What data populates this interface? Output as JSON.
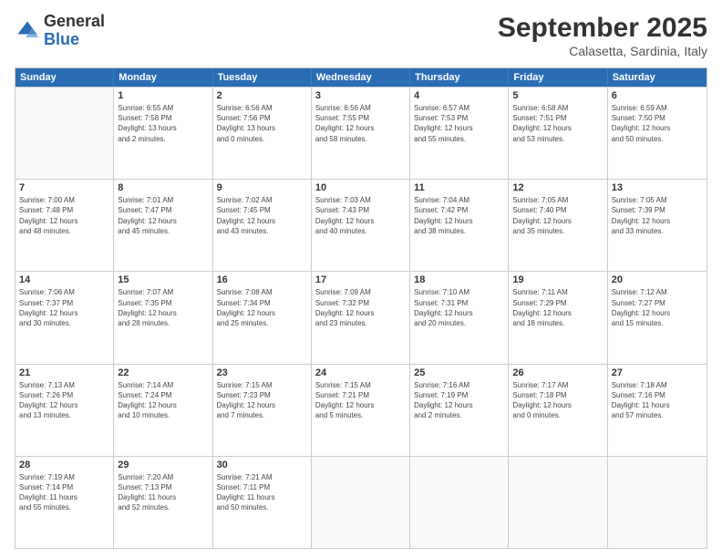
{
  "logo": {
    "general": "General",
    "blue": "Blue"
  },
  "header": {
    "month": "September 2025",
    "location": "Calasetta, Sardinia, Italy"
  },
  "weekdays": [
    "Sunday",
    "Monday",
    "Tuesday",
    "Wednesday",
    "Thursday",
    "Friday",
    "Saturday"
  ],
  "weeks": [
    [
      {
        "day": "",
        "info": ""
      },
      {
        "day": "1",
        "info": "Sunrise: 6:55 AM\nSunset: 7:58 PM\nDaylight: 13 hours\nand 2 minutes."
      },
      {
        "day": "2",
        "info": "Sunrise: 6:56 AM\nSunset: 7:56 PM\nDaylight: 13 hours\nand 0 minutes."
      },
      {
        "day": "3",
        "info": "Sunrise: 6:56 AM\nSunset: 7:55 PM\nDaylight: 12 hours\nand 58 minutes."
      },
      {
        "day": "4",
        "info": "Sunrise: 6:57 AM\nSunset: 7:53 PM\nDaylight: 12 hours\nand 55 minutes."
      },
      {
        "day": "5",
        "info": "Sunrise: 6:58 AM\nSunset: 7:51 PM\nDaylight: 12 hours\nand 53 minutes."
      },
      {
        "day": "6",
        "info": "Sunrise: 6:59 AM\nSunset: 7:50 PM\nDaylight: 12 hours\nand 50 minutes."
      }
    ],
    [
      {
        "day": "7",
        "info": "Sunrise: 7:00 AM\nSunset: 7:48 PM\nDaylight: 12 hours\nand 48 minutes."
      },
      {
        "day": "8",
        "info": "Sunrise: 7:01 AM\nSunset: 7:47 PM\nDaylight: 12 hours\nand 45 minutes."
      },
      {
        "day": "9",
        "info": "Sunrise: 7:02 AM\nSunset: 7:45 PM\nDaylight: 12 hours\nand 43 minutes."
      },
      {
        "day": "10",
        "info": "Sunrise: 7:03 AM\nSunset: 7:43 PM\nDaylight: 12 hours\nand 40 minutes."
      },
      {
        "day": "11",
        "info": "Sunrise: 7:04 AM\nSunset: 7:42 PM\nDaylight: 12 hours\nand 38 minutes."
      },
      {
        "day": "12",
        "info": "Sunrise: 7:05 AM\nSunset: 7:40 PM\nDaylight: 12 hours\nand 35 minutes."
      },
      {
        "day": "13",
        "info": "Sunrise: 7:05 AM\nSunset: 7:39 PM\nDaylight: 12 hours\nand 33 minutes."
      }
    ],
    [
      {
        "day": "14",
        "info": "Sunrise: 7:06 AM\nSunset: 7:37 PM\nDaylight: 12 hours\nand 30 minutes."
      },
      {
        "day": "15",
        "info": "Sunrise: 7:07 AM\nSunset: 7:35 PM\nDaylight: 12 hours\nand 28 minutes."
      },
      {
        "day": "16",
        "info": "Sunrise: 7:08 AM\nSunset: 7:34 PM\nDaylight: 12 hours\nand 25 minutes."
      },
      {
        "day": "17",
        "info": "Sunrise: 7:09 AM\nSunset: 7:32 PM\nDaylight: 12 hours\nand 23 minutes."
      },
      {
        "day": "18",
        "info": "Sunrise: 7:10 AM\nSunset: 7:31 PM\nDaylight: 12 hours\nand 20 minutes."
      },
      {
        "day": "19",
        "info": "Sunrise: 7:11 AM\nSunset: 7:29 PM\nDaylight: 12 hours\nand 18 minutes."
      },
      {
        "day": "20",
        "info": "Sunrise: 7:12 AM\nSunset: 7:27 PM\nDaylight: 12 hours\nand 15 minutes."
      }
    ],
    [
      {
        "day": "21",
        "info": "Sunrise: 7:13 AM\nSunset: 7:26 PM\nDaylight: 12 hours\nand 13 minutes."
      },
      {
        "day": "22",
        "info": "Sunrise: 7:14 AM\nSunset: 7:24 PM\nDaylight: 12 hours\nand 10 minutes."
      },
      {
        "day": "23",
        "info": "Sunrise: 7:15 AM\nSunset: 7:23 PM\nDaylight: 12 hours\nand 7 minutes."
      },
      {
        "day": "24",
        "info": "Sunrise: 7:15 AM\nSunset: 7:21 PM\nDaylight: 12 hours\nand 5 minutes."
      },
      {
        "day": "25",
        "info": "Sunrise: 7:16 AM\nSunset: 7:19 PM\nDaylight: 12 hours\nand 2 minutes."
      },
      {
        "day": "26",
        "info": "Sunrise: 7:17 AM\nSunset: 7:18 PM\nDaylight: 12 hours\nand 0 minutes."
      },
      {
        "day": "27",
        "info": "Sunrise: 7:18 AM\nSunset: 7:16 PM\nDaylight: 11 hours\nand 57 minutes."
      }
    ],
    [
      {
        "day": "28",
        "info": "Sunrise: 7:19 AM\nSunset: 7:14 PM\nDaylight: 11 hours\nand 55 minutes."
      },
      {
        "day": "29",
        "info": "Sunrise: 7:20 AM\nSunset: 7:13 PM\nDaylight: 11 hours\nand 52 minutes."
      },
      {
        "day": "30",
        "info": "Sunrise: 7:21 AM\nSunset: 7:11 PM\nDaylight: 11 hours\nand 50 minutes."
      },
      {
        "day": "",
        "info": ""
      },
      {
        "day": "",
        "info": ""
      },
      {
        "day": "",
        "info": ""
      },
      {
        "day": "",
        "info": ""
      }
    ]
  ]
}
